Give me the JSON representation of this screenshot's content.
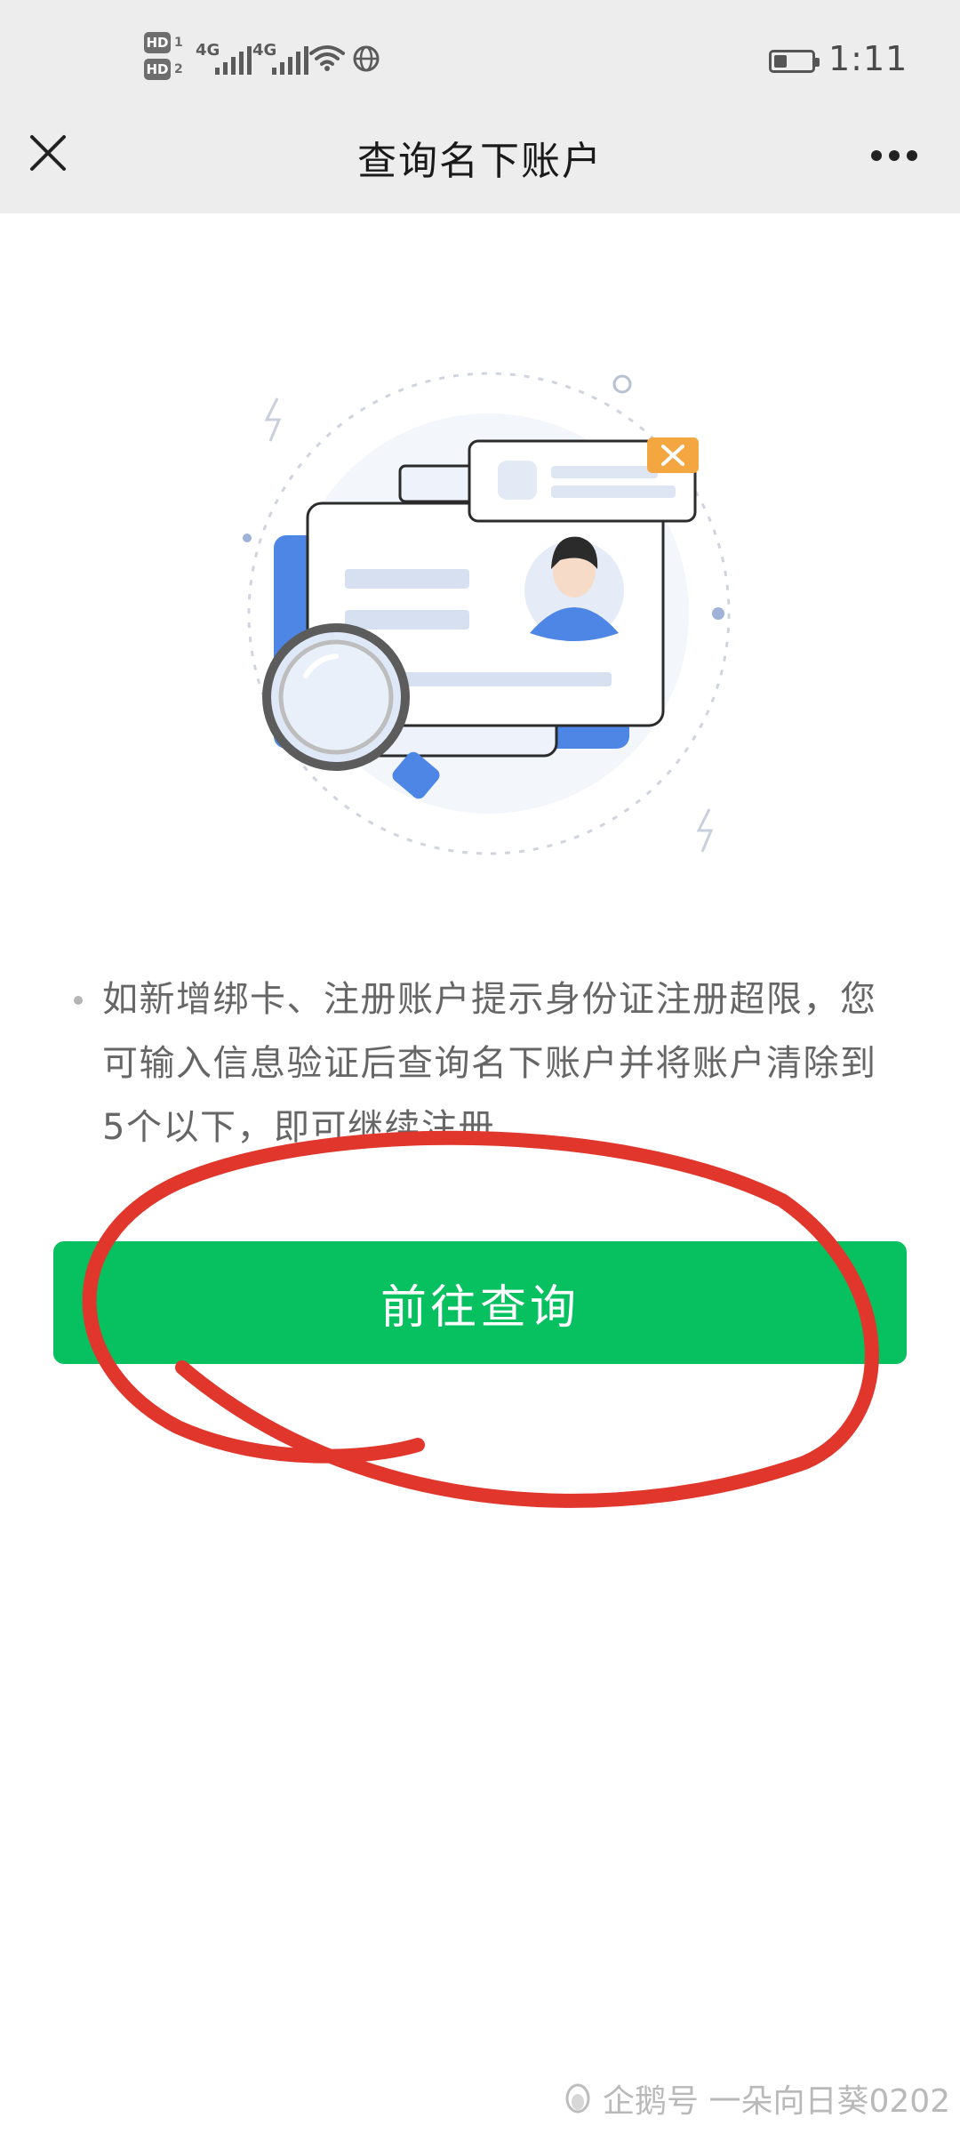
{
  "status_bar": {
    "hd1": "HD",
    "hd1_index": "1",
    "hd2": "HD",
    "hd2_index": "2",
    "signal1_label": "4G",
    "signal2_label": "4G",
    "time": "1:11",
    "battery_level_fraction": 0.35
  },
  "header": {
    "title": "查询名下账户",
    "close_icon": "close-icon",
    "more_icon": "more-icon"
  },
  "content": {
    "tip_text": "如新增绑卡、注册账户提示身份证注册超限，您可输入信息验证后查询名下账户并将账户清除到5个以下，即可继续注册"
  },
  "actions": {
    "primary_label": "前往查询"
  },
  "watermark": {
    "text": "企鹅号 一朵向日葵0202"
  },
  "colors": {
    "primary": "#07c160",
    "annotation_red": "#e0362c"
  }
}
